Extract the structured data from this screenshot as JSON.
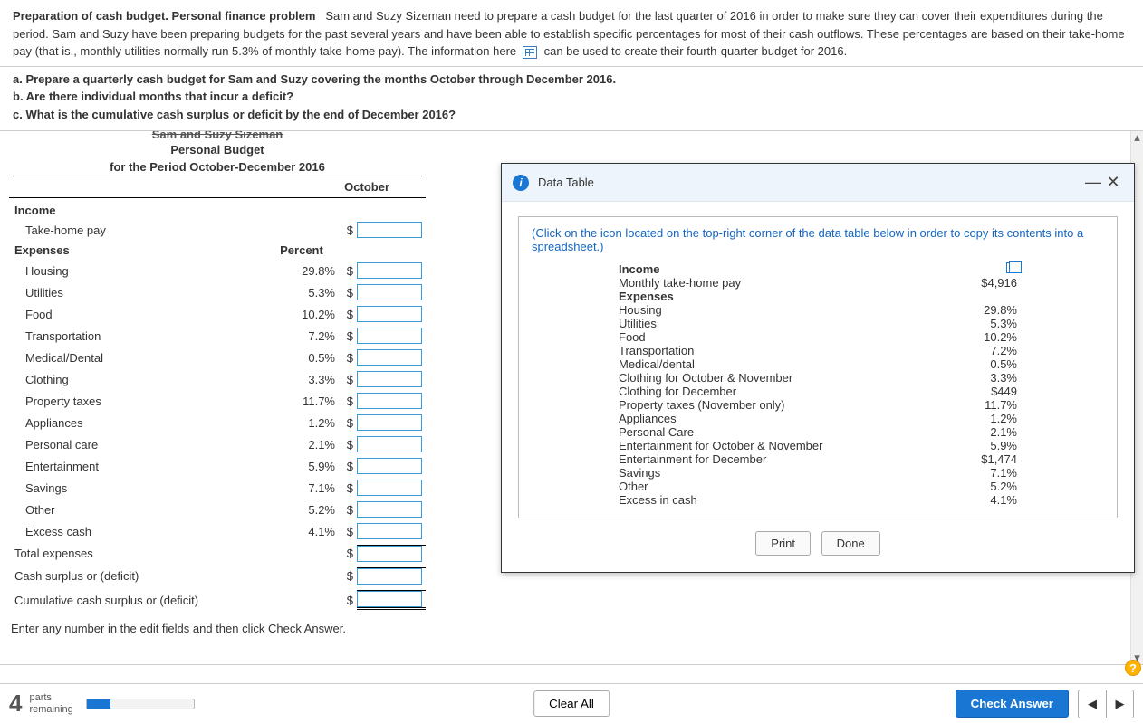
{
  "problem": {
    "title_bold": "Preparation of cash budget. Personal finance problem",
    "para1a": "Sam and Suzy Sizeman need to prepare a cash budget for the last quarter of 2016 in order to make sure they can cover their expenditures during the period. Sam and Suzy have been preparing budgets for the past several years and have been able to establish specific percentages for most of their cash outflows. These percentages are based on their take-home pay (that is., monthly utilities normally run 5.3% of monthly take-home pay). The information here",
    "para1b": "can be used to create their fourth-quarter budget for 2016.",
    "qa": "a. Prepare a quarterly cash budget for Sam and Suzy covering the months October through December 2016.",
    "qb": "b. Are there individual months that incur a deficit?",
    "qc": "c. What is the cumulative cash surplus or deficit by the end of December 2016?"
  },
  "budget": {
    "names_line": "Sam and Suzy Sizeman",
    "title": "Personal Budget",
    "subtitle": "for the Period October-December 2016",
    "month": "October",
    "income_head": "Income",
    "take_home": "Take-home pay",
    "expenses_head": "Expenses",
    "percent_head": "Percent",
    "rows": [
      {
        "label": "Housing",
        "pct": "29.8%"
      },
      {
        "label": "Utilities",
        "pct": "5.3%"
      },
      {
        "label": "Food",
        "pct": "10.2%"
      },
      {
        "label": "Transportation",
        "pct": "7.2%"
      },
      {
        "label": "Medical/Dental",
        "pct": "0.5%"
      },
      {
        "label": "Clothing",
        "pct": "3.3%"
      },
      {
        "label": "Property taxes",
        "pct": "11.7%"
      },
      {
        "label": "Appliances",
        "pct": "1.2%"
      },
      {
        "label": "Personal care",
        "pct": "2.1%"
      },
      {
        "label": "Entertainment",
        "pct": "5.9%"
      },
      {
        "label": "Savings",
        "pct": "7.1%"
      },
      {
        "label": "Other",
        "pct": "5.2%"
      },
      {
        "label": "Excess cash",
        "pct": "4.1%"
      }
    ],
    "total_exp": "Total expenses",
    "surplus": "Cash surplus or (deficit)",
    "cum_surplus": "Cumulative cash surplus or (deficit)",
    "hint": "Enter any number in the edit fields and then click Check Answer."
  },
  "modal": {
    "title": "Data Table",
    "note": "(Click on the icon located on the top-right corner of the data table below in order to copy its contents into a spreadsheet.)",
    "income_head": "Income",
    "expenses_head": "Expenses",
    "items": [
      {
        "k": "Monthly take-home pay",
        "v": "$4,916"
      },
      {
        "k": "Housing",
        "v": "29.8%"
      },
      {
        "k": "Utilities",
        "v": "5.3%"
      },
      {
        "k": "Food",
        "v": "10.2%"
      },
      {
        "k": "Transportation",
        "v": "7.2%"
      },
      {
        "k": "Medical/dental",
        "v": "0.5%"
      },
      {
        "k": "Clothing for October & November",
        "v": "3.3%"
      },
      {
        "k": "Clothing for December",
        "v": "$449"
      },
      {
        "k": "Property taxes (November only)",
        "v": "11.7%"
      },
      {
        "k": "Appliances",
        "v": "1.2%"
      },
      {
        "k": "Personal Care",
        "v": "2.1%"
      },
      {
        "k": "Entertainment for October & November",
        "v": "5.9%"
      },
      {
        "k": "Entertainment for December",
        "v": "$1,474"
      },
      {
        "k": "Savings",
        "v": "7.1%"
      },
      {
        "k": "Other",
        "v": "5.2%"
      },
      {
        "k": "Excess in cash",
        "v": "4.1%"
      }
    ],
    "print": "Print",
    "done": "Done"
  },
  "footer": {
    "parts_num": "4",
    "parts_label1": "parts",
    "parts_label2": "remaining",
    "clear": "Clear All",
    "check": "Check Answer"
  }
}
